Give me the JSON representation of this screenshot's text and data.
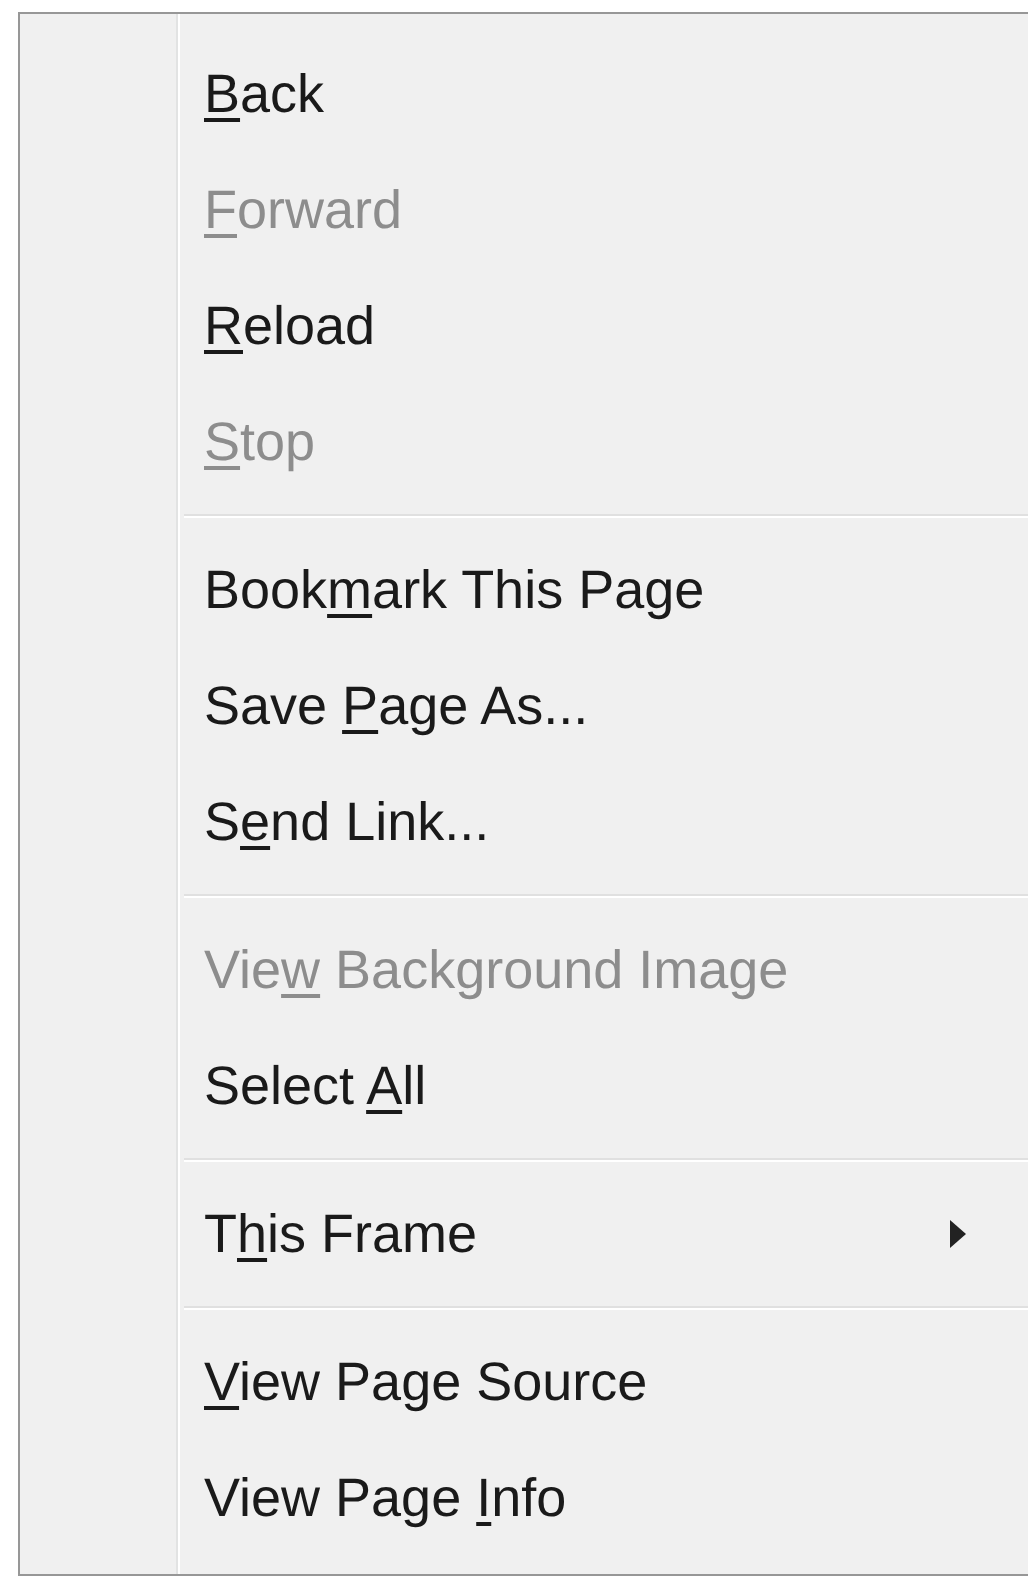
{
  "context_menu": {
    "sections": [
      [
        {
          "access_key": "B",
          "text_after": "ack",
          "disabled": false,
          "submenu": false
        },
        {
          "access_key": "F",
          "text_after": "orward",
          "disabled": true,
          "submenu": false
        },
        {
          "access_key": "R",
          "text_after": "eload",
          "disabled": false,
          "submenu": false
        },
        {
          "access_key": "S",
          "text_after": "top",
          "disabled": true,
          "submenu": false
        }
      ],
      [
        {
          "text_before": "Book",
          "access_key": "m",
          "text_after": "ark This Page",
          "disabled": false,
          "submenu": false
        },
        {
          "text_before": "Save ",
          "access_key": "P",
          "text_after": "age As...",
          "disabled": false,
          "submenu": false
        },
        {
          "text_before": "S",
          "access_key": "e",
          "text_after": "nd Link...",
          "disabled": false,
          "submenu": false
        }
      ],
      [
        {
          "text_before": "Vie",
          "access_key": "w",
          "text_after": " Background Image",
          "disabled": true,
          "submenu": false
        },
        {
          "text_before": "Select ",
          "access_key": "A",
          "text_after": "ll",
          "disabled": false,
          "submenu": false
        }
      ],
      [
        {
          "text_before": "T",
          "access_key": "h",
          "text_after": "is Frame",
          "disabled": false,
          "submenu": true
        }
      ],
      [
        {
          "access_key": "V",
          "text_after": "iew Page Source",
          "disabled": false,
          "submenu": false
        },
        {
          "text_before": "View Page ",
          "access_key": "I",
          "text_after": "nfo",
          "disabled": false,
          "submenu": false
        }
      ]
    ]
  }
}
